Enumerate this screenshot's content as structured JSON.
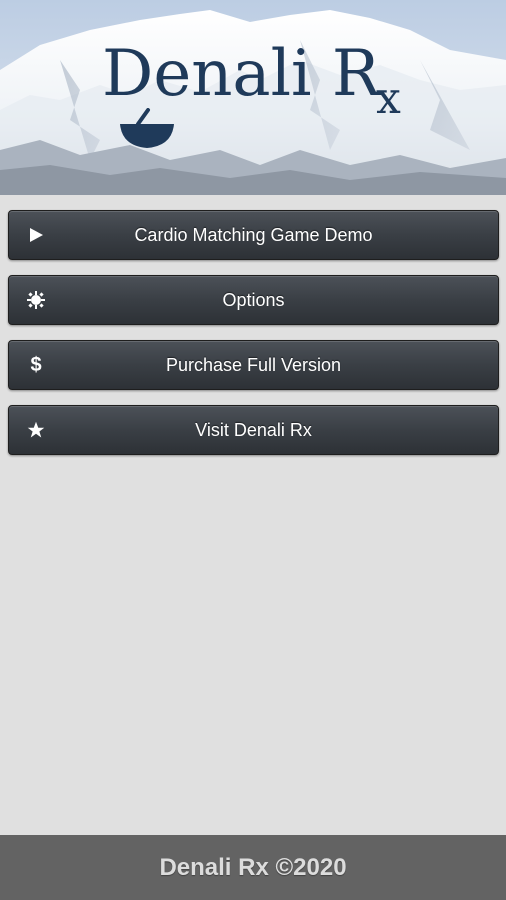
{
  "header": {
    "logo_text": "Denali R",
    "logo_sub": "x",
    "image": "mountain-banner"
  },
  "menu": {
    "items": [
      {
        "label": "Cardio Matching Game Demo",
        "icon": "play-icon"
      },
      {
        "label": "Options",
        "icon": "gear-icon"
      },
      {
        "label": "Purchase Full Version",
        "icon": "dollar-icon",
        "glyph": "$"
      },
      {
        "label": "Visit Denali Rx",
        "icon": "star-icon"
      }
    ]
  },
  "footer": {
    "text": "Denali Rx ©2020"
  },
  "colors": {
    "background": "#e0e0e0",
    "button": "#3a3f45",
    "footer": "#636363",
    "logo": "#1f3a5a"
  }
}
